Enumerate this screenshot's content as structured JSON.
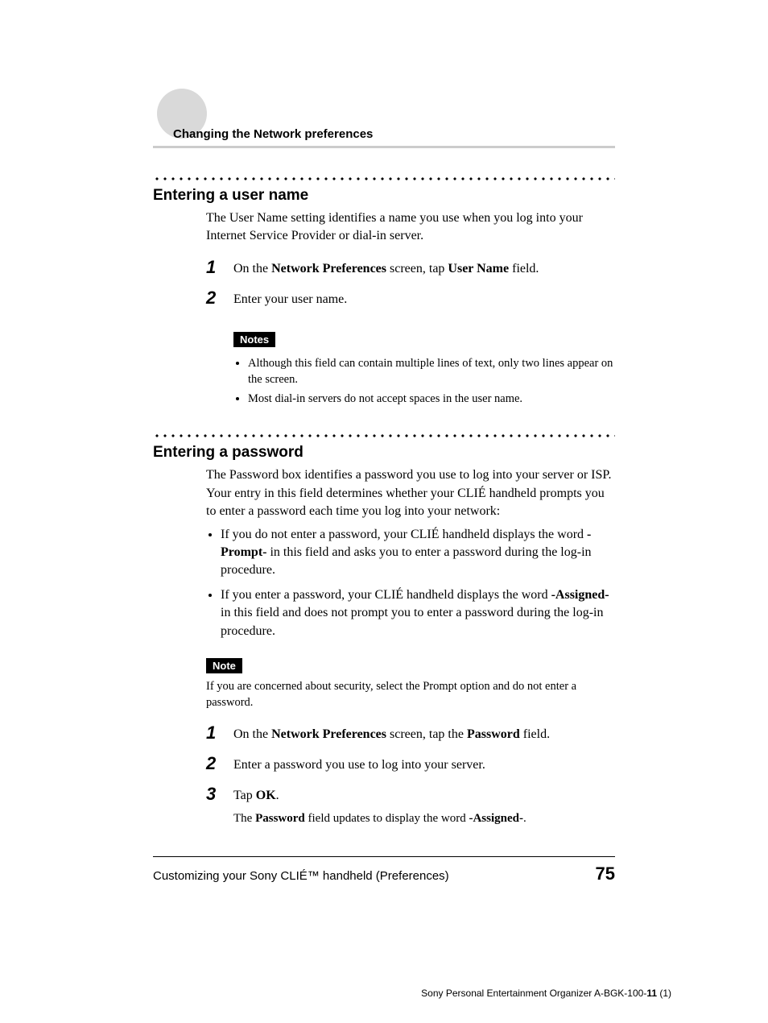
{
  "header": {
    "chapter": "Changing the Network preferences"
  },
  "section1": {
    "title": "Entering a user name",
    "intro": "The User Name setting identifies a name you use when you log into your Internet Service Provider or dial-in server.",
    "steps": {
      "s1_pre": "On the ",
      "s1_b1": "Network Preferences",
      "s1_mid": " screen, tap ",
      "s1_b2": "User Name",
      "s1_post": " field.",
      "s2": "Enter your user name."
    },
    "notes_label": "Notes",
    "notes": {
      "n1": "Although this field can contain multiple lines of text, only two lines appear on the screen.",
      "n2": "Most dial-in servers do not accept spaces in the user name."
    }
  },
  "section2": {
    "title": "Entering a password",
    "intro": "The Password box identifies a password you use to log into your server or ISP. Your entry in this field determines whether your CLIÉ handheld prompts you to enter a password each time you log into your network:",
    "bullets": {
      "b1_pre": "If you do not enter a password, your CLIÉ handheld displays the word ",
      "b1_bold": "-Prompt-",
      "b1_post": " in this field and asks you to enter a password during the log-in procedure.",
      "b2_pre": "If you enter a password, your CLIÉ handheld displays the word ",
      "b2_bold": "-Assigned-",
      "b2_post": " in this field and does not prompt you to enter a password during the log-in procedure."
    },
    "note_label": "Note",
    "note_text": "If you are concerned about security, select the Prompt option and do not enter a password.",
    "steps": {
      "s1_pre": "On the ",
      "s1_b1": "Network Preferences",
      "s1_mid": " screen, tap the ",
      "s1_b2": "Password",
      "s1_post": " field.",
      "s2": "Enter a password you use to log into your server.",
      "s3_pre": "Tap ",
      "s3_b": "OK",
      "s3_post": ".",
      "s3_sub_pre": "The ",
      "s3_sub_b1": "Password",
      "s3_sub_mid": " field updates to display the word ",
      "s3_sub_b2": "-Assigned-",
      "s3_sub_post": "."
    }
  },
  "footer": {
    "left": "Customizing your Sony CLIÉ™ handheld (Preferences)",
    "page": "75",
    "bottom_pre": "Sony Personal Entertainment Organizer  A-BGK-100-",
    "bottom_b": "11",
    "bottom_post": " (1)"
  }
}
